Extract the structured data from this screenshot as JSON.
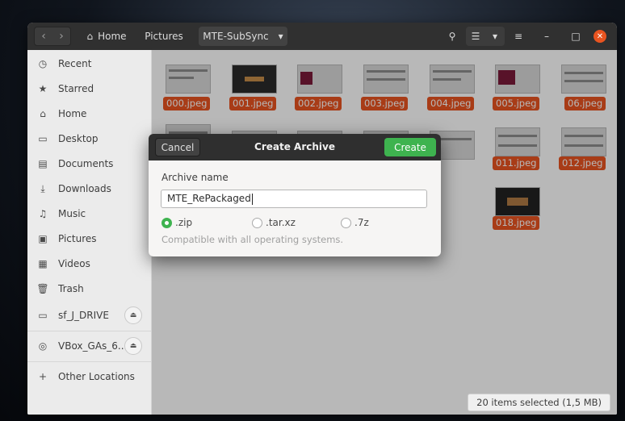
{
  "headerbar": {
    "path": [
      "Home",
      "Pictures",
      "MTE-SubSync"
    ],
    "icons": [
      "back-icon",
      "forward-icon",
      "home-icon",
      "search-icon",
      "list-view-icon",
      "menu-icon",
      "minimize-icon",
      "maximize-icon",
      "close-icon"
    ]
  },
  "sidebar": {
    "items": [
      {
        "label": "Recent",
        "icon": "clock-icon"
      },
      {
        "label": "Starred",
        "icon": "star-icon"
      },
      {
        "label": "Home",
        "icon": "home-icon"
      },
      {
        "label": "Desktop",
        "icon": "desktop-icon"
      },
      {
        "label": "Documents",
        "icon": "document-icon"
      },
      {
        "label": "Downloads",
        "icon": "download-icon"
      },
      {
        "label": "Music",
        "icon": "music-icon"
      },
      {
        "label": "Pictures",
        "icon": "picture-icon"
      },
      {
        "label": "Videos",
        "icon": "video-icon"
      },
      {
        "label": "Trash",
        "icon": "trash-icon"
      },
      {
        "label": "sf_J_DRIVE",
        "icon": "drive-icon"
      },
      {
        "label": "VBox_GAs_6...",
        "icon": "disc-icon"
      },
      {
        "label": "Other Locations",
        "icon": "plus-icon"
      }
    ]
  },
  "files": [
    "000.jpeg",
    "001.jpeg",
    "002.jpeg",
    "003.jpeg",
    "004.jpeg",
    "005.jpeg",
    "06.jpeg",
    "011.jpeg",
    "012.jpeg",
    "018.jpeg"
  ],
  "status": "20 items selected (1,5 MB)",
  "dialog": {
    "title": "Create Archive",
    "cancel": "Cancel",
    "create": "Create",
    "name_label": "Archive name",
    "name_value": "MTE_RePackaged",
    "formats": [
      ".zip",
      ".tar.xz",
      ".7z"
    ],
    "selected_format": ".zip",
    "hint": "Compatible with all operating systems."
  },
  "colors": {
    "accent": "#e95420",
    "create": "#3eb34f",
    "headerbar": "#303030"
  }
}
